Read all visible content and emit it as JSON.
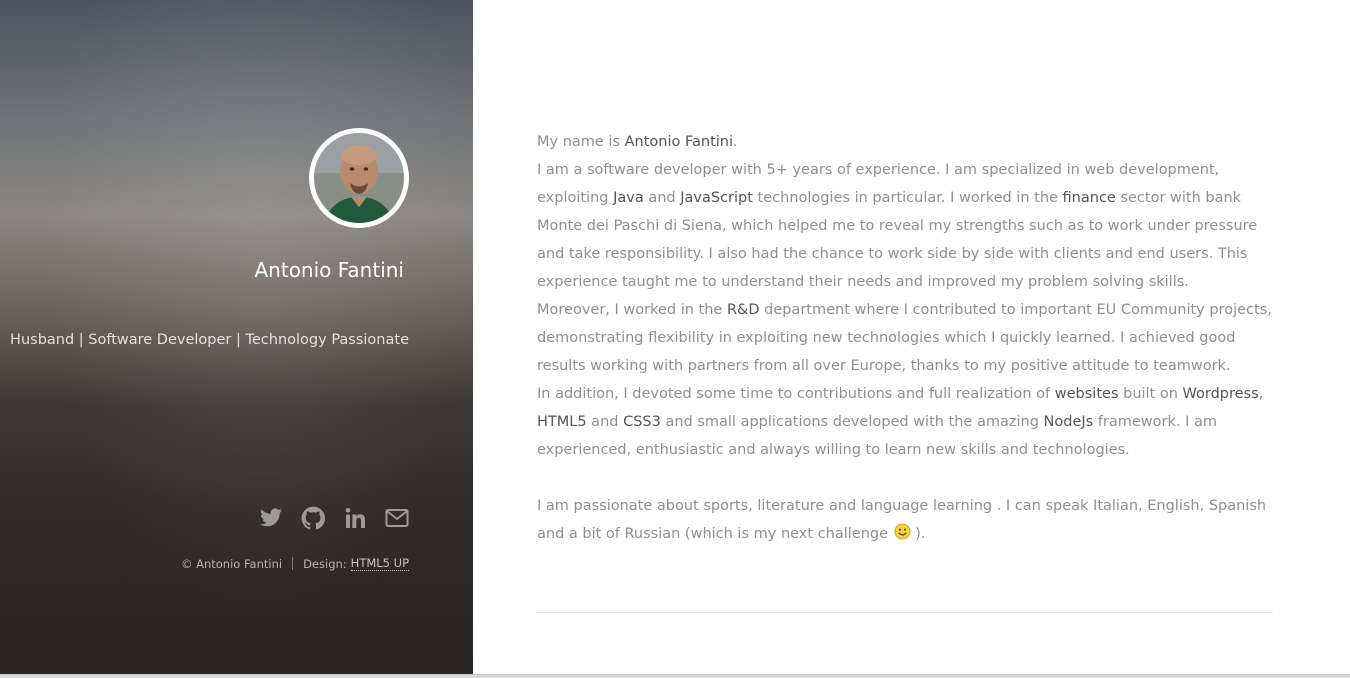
{
  "profile": {
    "name": "Antonio Fantini",
    "tagline": "Husband | Software Developer | Technology Passionate"
  },
  "social": [
    {
      "icon": "twitter-icon"
    },
    {
      "icon": "github-icon"
    },
    {
      "icon": "linkedin-icon"
    },
    {
      "icon": "envelope-icon"
    }
  ],
  "credits": {
    "copyright": "© Antonio Fantini",
    "design_label": "Design:",
    "design_link": "HTML5 UP"
  },
  "bio": {
    "p1_a": "My name is ",
    "p1_name": "Antonio Fantini",
    "p1_b": ".",
    "p2_a": "I am a software developer with 5+ years of experience. I am specialized in web development, exploiting ",
    "p2_java": "Java",
    "p2_b": " and ",
    "p2_js": "JavaScript",
    "p2_c": " technologies in particular. I worked in the ",
    "p2_finance": "finance",
    "p2_d": " sector with bank Monte dei Paschi di Siena, which helped me to reveal my strengths such as to work under pressure and take responsibility. I also had the chance to work side by side with clients and end users. This experience taught me to understand their needs and improved my problem solving skills.",
    "p3_a": "Moreover, I worked in the ",
    "p3_rd": "R&D",
    "p3_b": " department where I contributed to important EU Community projects, demonstrating flexibility in exploiting new technologies which I quickly learned. I achieved good results working with partners from all over Europe, thanks to my positive attitude to teamwork.",
    "p4_a": "In addition, I devoted some time to contributions and full realization of ",
    "p4_websites": "websites",
    "p4_b": " built on ",
    "p4_wordpress": "Wordpress",
    "p4_c": ", ",
    "p4_html5": "HTML5",
    "p4_d": " and ",
    "p4_css3": "CSS3",
    "p4_e": " and small applications developed with the amazing ",
    "p4_nodejs": "NodeJs",
    "p4_f": " framework. I am experienced, enthusiastic and always willing to learn new skills and technologies.",
    "p5_a": "I am passionate about sports, literature and language learning . I can speak Italian, English, Spanish and a bit of Russian (which is my next challenge ",
    "p5_emoji": "smiley-face-icon",
    "p5_b": " )."
  },
  "colors": {
    "text": "#8f8f8f",
    "highlight": "#555555",
    "sidebar_top": "#4b5560",
    "sidebar_bottom": "#2a2420"
  }
}
